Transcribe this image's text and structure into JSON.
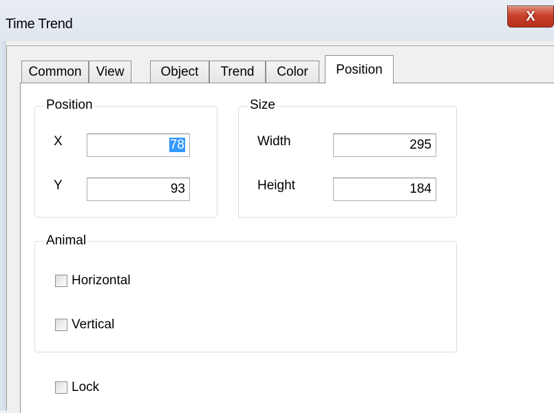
{
  "window": {
    "title": "Time Trend",
    "close_label": "X"
  },
  "tabs": [
    "Common",
    "View",
    "Object",
    "Trend",
    "Color",
    "Position"
  ],
  "active_tab": "Position",
  "position_group": {
    "label": "Position",
    "x_label": "X",
    "x_value": "78",
    "y_label": "Y",
    "y_value": "93"
  },
  "size_group": {
    "label": "Size",
    "width_label": "Width",
    "width_value": "295",
    "height_label": "Height",
    "height_value": "184"
  },
  "animal_group": {
    "label": "Animal",
    "horizontal_label": "Horizontal",
    "horizontal_checked": false,
    "vertical_label": "Vertical",
    "vertical_checked": false
  },
  "lock": {
    "label": "Lock",
    "checked": false
  }
}
